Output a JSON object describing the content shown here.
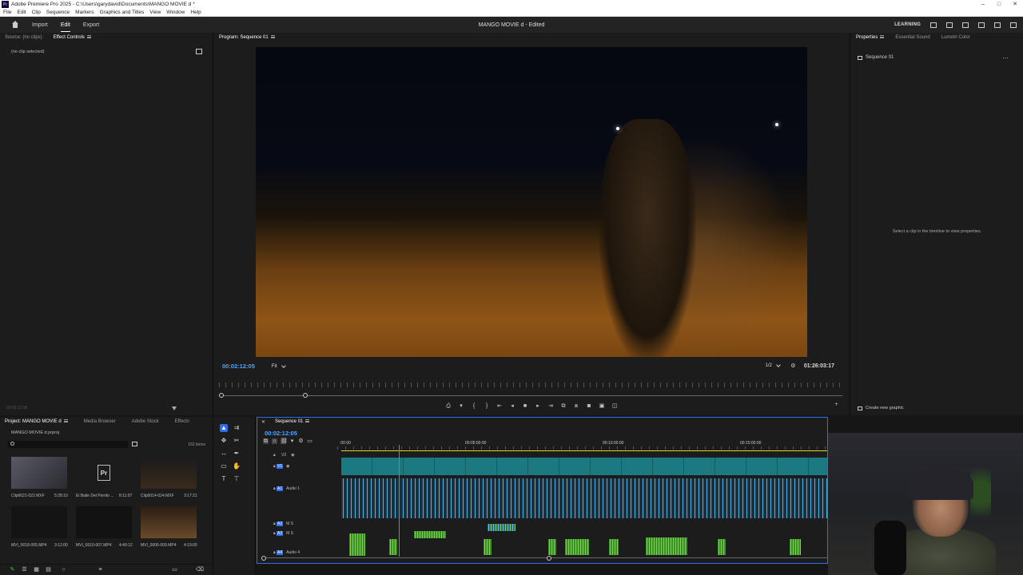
{
  "app": {
    "window_title": "Adobe Premiere Pro 2025 - C:\\Users\\garydavid\\Documents\\MANGO MOVIE d *",
    "window_controls": [
      "–",
      "□",
      "✕"
    ]
  },
  "menu": [
    "File",
    "Edit",
    "Clip",
    "Sequence",
    "Markers",
    "Graphics and Titles",
    "View",
    "Window",
    "Help"
  ],
  "workspace": {
    "tabs": [
      "Import",
      "Edit",
      "Export"
    ],
    "active_tab": "Edit",
    "doc_title": "MANGO MOVIE d - Edited",
    "learning": "LEARNING"
  },
  "effect_panel": {
    "tabs": [
      "Source: (no clips)",
      "Effect Controls"
    ],
    "active_tab": "Effect Controls",
    "no_clip": "(no clip selected)",
    "time": "00:02:12:05"
  },
  "program": {
    "tab": "Program: Sequence 01",
    "timecode": "00:02:12:05",
    "fit": "Fit",
    "resolution": "1/2",
    "duration": "01:26:03:17"
  },
  "properties": {
    "tabs": [
      "Properties",
      "Essential Sound",
      "Lumetri Color"
    ],
    "active_tab": "Properties",
    "sequence": "Sequence 01",
    "hint": "Select a clip in the timeline to view properties.",
    "create": "Create new graphic",
    "more": "…"
  },
  "project": {
    "tabs": [
      "Project: MANGO MOVIE d",
      "Media Browser",
      "Adobe Stock",
      "Effects"
    ],
    "active_tab": "Project: MANGO MOVIE d",
    "file": "MANGO MOVIE d.prproj",
    "count": "162 items",
    "items": [
      {
        "name": "Clip0021-022.MXF",
        "duration": "5:28:10"
      },
      {
        "name": "El Baile Del Perrito ...",
        "duration": "8:11:07"
      },
      {
        "name": "Clip0014-024.MXF",
        "duration": "3:17:21"
      },
      {
        "name": "MVI_0018-005.MP4",
        "duration": "3:12:00"
      },
      {
        "name": "MVI_0010-007.MP4",
        "duration": "4:40:12"
      },
      {
        "name": "MVI_0006-009.MP4",
        "duration": "4:19:00"
      }
    ]
  },
  "timeline": {
    "tab": "Sequence 01",
    "timecode": "00:02:12:05",
    "ruler": [
      ":00:00",
      "00:05:00:00",
      "00:10:00:00",
      "00:15:00:00"
    ],
    "tracks": {
      "v2": "V2",
      "v1": "V1",
      "a1": "A1",
      "a1_name": "Audio 1",
      "a2": "A2",
      "a3": "A3",
      "a4": "A4",
      "a4_name": "Audio 4"
    }
  },
  "colors": {
    "accent": "#2d6ef0",
    "timecode": "#4ea5ff",
    "video_clip": "#1b7a81",
    "audio_clip": "#4fb6e8",
    "audio_clip_green": "#3a8f2a"
  }
}
